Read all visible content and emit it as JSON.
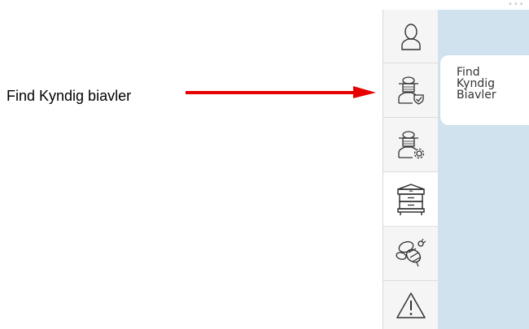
{
  "annotation": {
    "text": "Find Kyndig biavler",
    "arrow_color": "#e60000"
  },
  "sidebar": {
    "items": [
      {
        "icon": "person-icon",
        "active": false
      },
      {
        "icon": "beekeeper-shield-icon",
        "active": false
      },
      {
        "icon": "beekeeper-gear-icon",
        "active": false
      },
      {
        "icon": "beehive-icon",
        "active": true
      },
      {
        "icon": "bee-icon",
        "active": false
      },
      {
        "icon": "warning-icon",
        "active": false
      }
    ]
  },
  "tooltip": {
    "line1": "Find",
    "line2": "Kyndig",
    "line3": "Biavler"
  },
  "colors": {
    "sidebar_bg": "#f5f5f5",
    "content_bg": "#cfe2ee",
    "icon_stroke": "#333333"
  }
}
